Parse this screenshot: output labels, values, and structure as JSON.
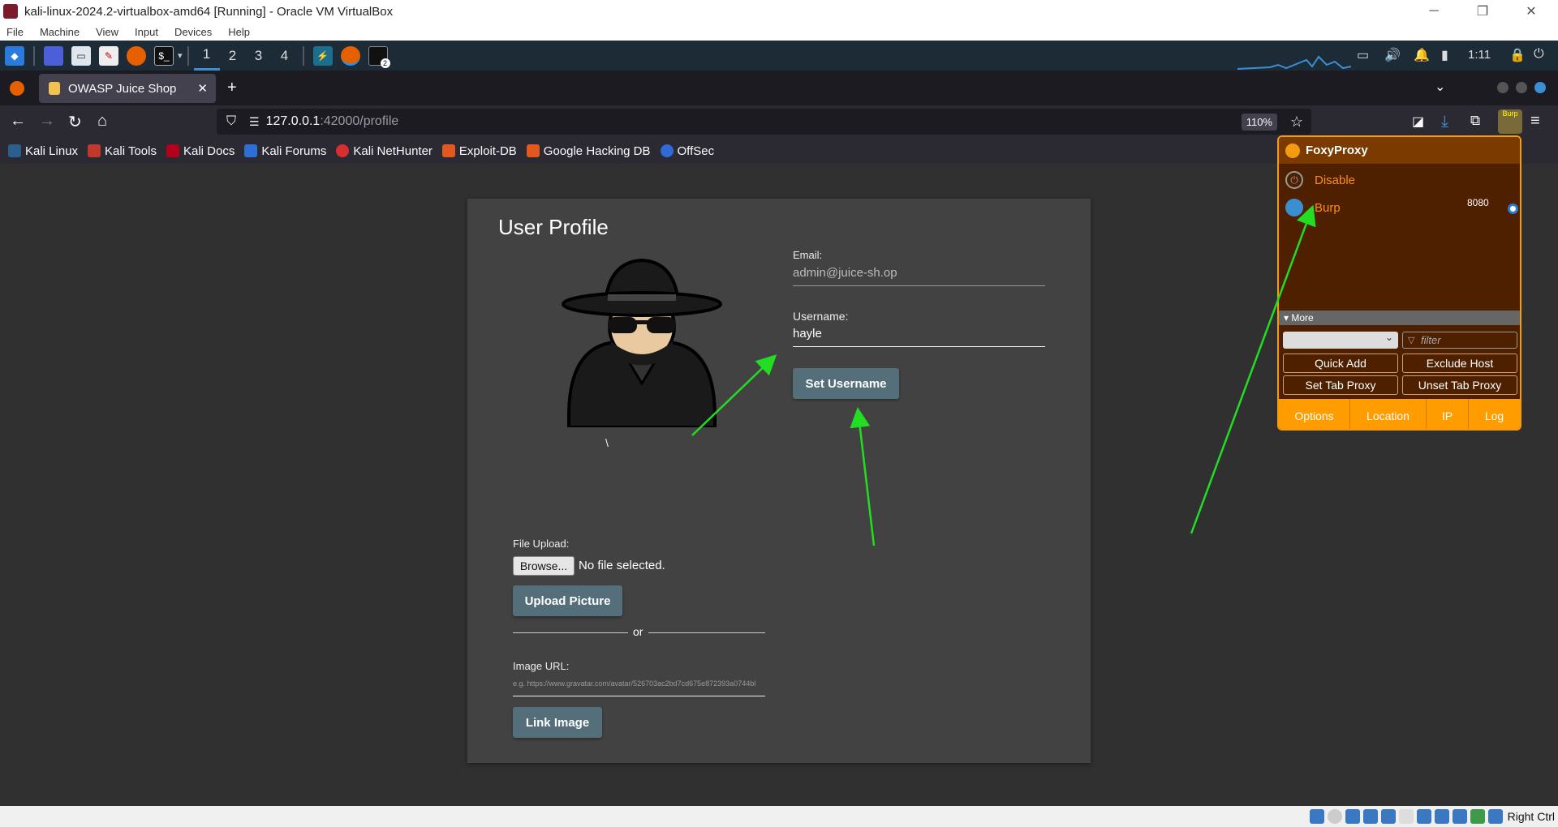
{
  "vbox": {
    "title": "kali-linux-2024.2-virtualbox-amd64 [Running] - Oracle VM VirtualBox",
    "menu": [
      "File",
      "Machine",
      "View",
      "Input",
      "Devices",
      "Help"
    ],
    "host_key": "Right Ctrl"
  },
  "panel": {
    "workspaces": [
      "1",
      "2",
      "3",
      "4"
    ],
    "time": "1:11",
    "terminal_badge": "2"
  },
  "browser": {
    "tab_title": "OWASP Juice Shop",
    "url_host": "127.0.0.1",
    "url_rest": ":42000/profile",
    "zoom": "110%",
    "bookmarks": [
      "Kali Linux",
      "Kali Tools",
      "Kali Docs",
      "Kali Forums",
      "Kali NetHunter",
      "Exploit-DB",
      "Google Hacking DB",
      "OffSec"
    ]
  },
  "profile": {
    "heading": "User Profile",
    "email_label": "Email:",
    "email_value": "admin@juice-sh.op",
    "username_label": "Username:",
    "username_value": "hayle",
    "set_username_btn": "Set Username",
    "caption": "\\",
    "file_upload_label": "File Upload:",
    "browse_btn": "Browse...",
    "no_file": "No file selected.",
    "upload_btn": "Upload Picture",
    "or_text": "or",
    "image_url_label": "Image URL:",
    "image_url_placeholder": "e.g. https://www.gravatar.com/avatar/526703ac2bd7cd675e872393a0744bl",
    "link_btn": "Link Image"
  },
  "foxyproxy": {
    "title": "FoxyProxy",
    "disable": "Disable",
    "proxy_name": "Burp",
    "proxy_port": "8080",
    "more": "▾ More",
    "filter_placeholder": "filter",
    "quick_add": "Quick Add",
    "exclude_host": "Exclude Host",
    "set_tab_proxy": "Set Tab Proxy",
    "unset_tab_proxy": "Unset Tab Proxy",
    "footer": [
      "Options",
      "Location",
      "IP",
      "Log"
    ],
    "toolbar_badge": "Burp"
  },
  "colors": {
    "accent_orange": "#ff9c00",
    "foxy_bg": "#4e2000",
    "button_slate": "#546e7a",
    "annotation_green": "#22dd22"
  }
}
